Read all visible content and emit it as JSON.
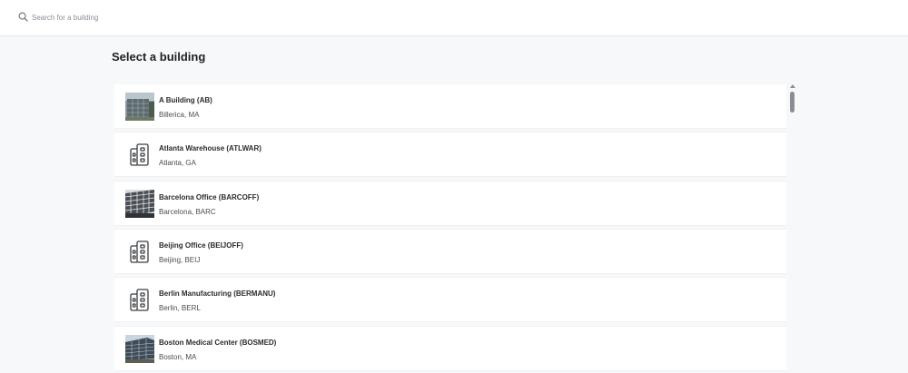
{
  "search": {
    "placeholder": "Search for a building",
    "icon": "search-icon"
  },
  "page": {
    "title": "Select a building"
  },
  "buildings": [
    {
      "name": "A Building (AB)",
      "location": "Billerica, MA",
      "thumb": "photo"
    },
    {
      "name": "Atlanta Warehouse (ATLWAR)",
      "location": "Atlanta, GA",
      "thumb": "building-icon"
    },
    {
      "name": "Barcelona Office (BARCOFF)",
      "location": "Barcelona, BARC",
      "thumb": "photo"
    },
    {
      "name": "Beijing Office (BEIJOFF)",
      "location": "Beijing, BEIJ",
      "thumb": "building-icon"
    },
    {
      "name": "Berlin Manufacturing (BERMANU)",
      "location": "Berlin, BERL",
      "thumb": "building-icon"
    },
    {
      "name": "Boston Medical Center (BOSMED)",
      "location": "Boston, MA",
      "thumb": "photo"
    }
  ]
}
